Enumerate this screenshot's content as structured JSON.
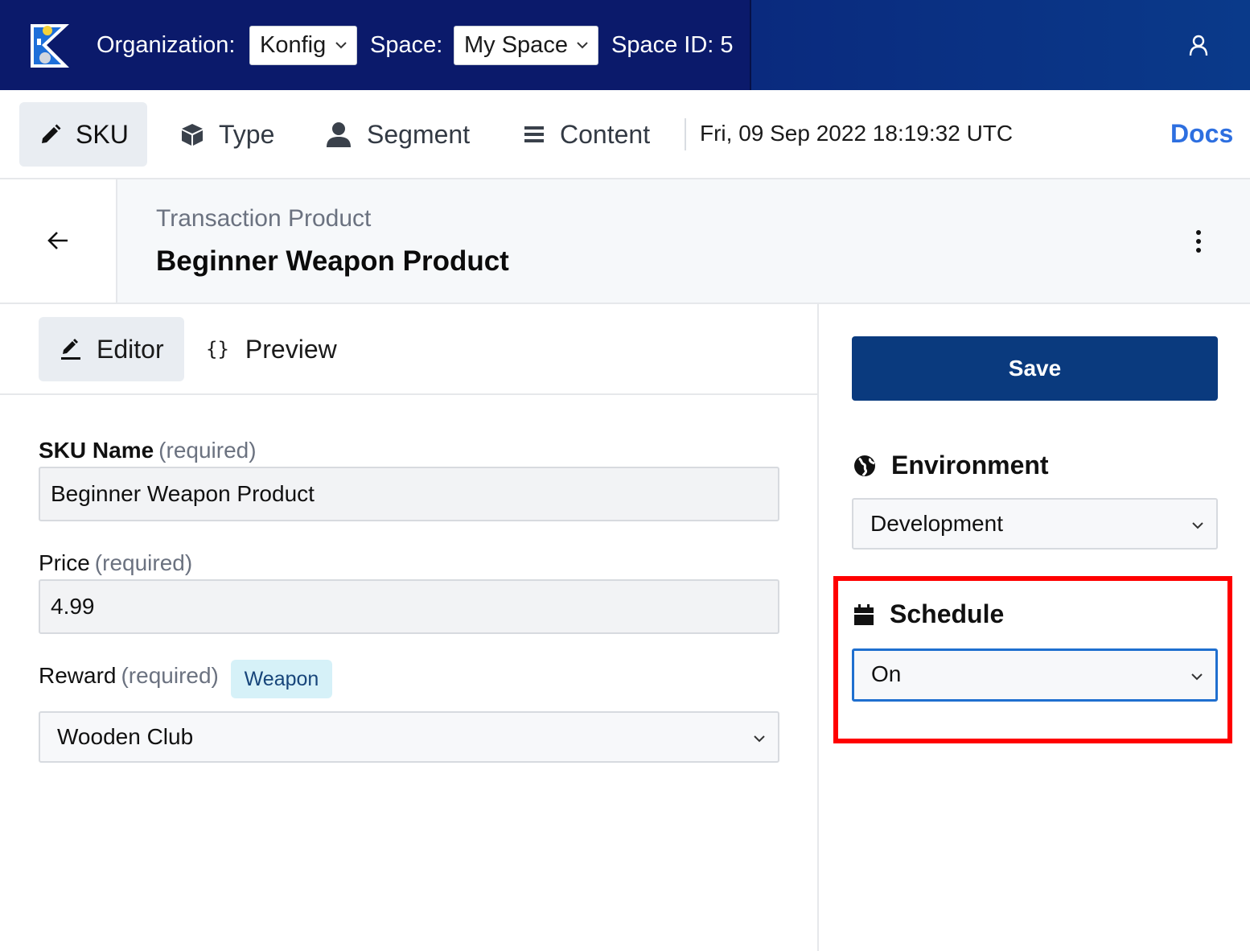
{
  "topbar": {
    "organization_label": "Organization:",
    "organization_value": "Konfig",
    "space_label": "Space:",
    "space_value": "My Space",
    "space_id": "Space ID: 5",
    "logo_icon": "konfig-logo-icon",
    "user_icon": "user-icon"
  },
  "nav": {
    "items": [
      {
        "label": "SKU",
        "icon": "pencil-icon",
        "active": true
      },
      {
        "label": "Type",
        "icon": "cube-icon",
        "active": false
      },
      {
        "label": "Segment",
        "icon": "user-icon",
        "active": false
      },
      {
        "label": "Content",
        "icon": "list-icon",
        "active": false
      }
    ],
    "datetime": "Fri, 09 Sep 2022 18:19:32 UTC",
    "docs_label": "Docs"
  },
  "header": {
    "subtitle": "Transaction Product",
    "title": "Beginner Weapon Product"
  },
  "editor": {
    "tabs": [
      {
        "label": "Editor",
        "icon": "edit-icon",
        "active": true
      },
      {
        "label": "Preview",
        "icon": "braces-icon",
        "active": false
      }
    ],
    "fields": {
      "sku_name_label": "SKU Name",
      "sku_name_required": "(required)",
      "sku_name_value": "Beginner Weapon Product",
      "price_label": "Price",
      "price_required": "(required)",
      "price_value": "4.99",
      "reward_label": "Reward",
      "reward_required": "(required)",
      "reward_badge": "Weapon",
      "reward_value": "Wooden Club"
    }
  },
  "sidebar": {
    "save_label": "Save",
    "environment_label": "Environment",
    "environment_value": "Development",
    "schedule_label": "Schedule",
    "schedule_value": "On"
  },
  "colors": {
    "topbar": "#0b1a6b",
    "save_button": "#0a3a7e",
    "docs_link": "#2d6fe0",
    "highlight": "#ff0000",
    "badge_bg": "#d6f1f8"
  }
}
